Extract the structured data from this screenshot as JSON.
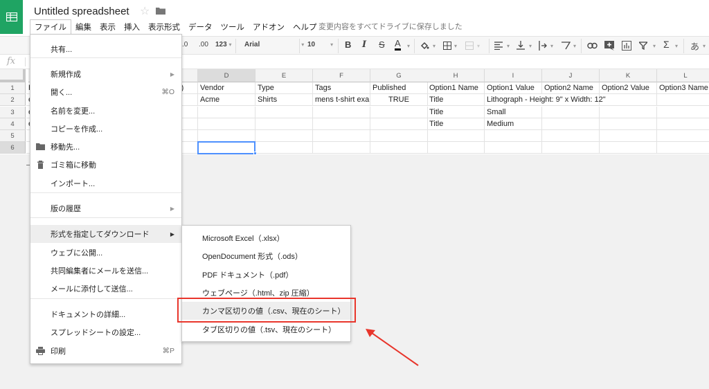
{
  "header": {
    "title": "Untitled spreadsheet",
    "star_icon": "star-outline-icon",
    "folder_icon": "folder-icon",
    "save_status": "変更内容をすべてドライブに保存しました",
    "menubar": [
      {
        "label": "ファイル",
        "active": true
      },
      {
        "label": "編集"
      },
      {
        "label": "表示"
      },
      {
        "label": "挿入"
      },
      {
        "label": "表示形式"
      },
      {
        "label": "データ"
      },
      {
        "label": "ツール"
      },
      {
        "label": "アドオン"
      },
      {
        "label": "ヘルプ"
      }
    ]
  },
  "toolbar": {
    "decrease_decimal": ".0",
    "increase_decimal": ".00",
    "number_format": "123",
    "font": "Arial",
    "font_size": "10",
    "bold": "B",
    "italic": "I",
    "strike": "S",
    "text_color": "A",
    "sigma": "Σ",
    "input_tools": "あ"
  },
  "formula_bar": {
    "fx_label": "fx",
    "value": ""
  },
  "grid": {
    "columns": [
      "D",
      "E",
      "F",
      "G",
      "H",
      "I",
      "J",
      "K",
      "L"
    ],
    "selected_column": "D",
    "rows": [
      "1",
      "2",
      "3",
      "4",
      "5",
      "6"
    ],
    "selected_row": "6",
    "partial_col_c_row1": "-)",
    "partial_col_a": [
      "H",
      "e",
      "e",
      "e",
      "",
      ""
    ],
    "cells": [
      [
        "Vendor",
        "Type",
        "Tags",
        "Published",
        "Option1 Name",
        "Option1 Value",
        "Option2 Name",
        "Option2 Value",
        "Option3 Name"
      ],
      [
        "Acme",
        "Shirts",
        "mens t-shirt exar",
        "TRUE",
        "Title",
        "Lithograph - Height: 9\" x Width: 12\"",
        "",
        "",
        ""
      ],
      [
        "",
        "",
        "",
        "",
        "Title",
        "Small",
        "",
        "",
        ""
      ],
      [
        "",
        "",
        "",
        "",
        "Title",
        "Medium",
        "",
        "",
        ""
      ],
      [
        "",
        "",
        "",
        "",
        "",
        "",
        "",
        "",
        ""
      ],
      [
        "",
        "",
        "",
        "",
        "",
        "",
        "",
        "",
        ""
      ]
    ],
    "active_cell": "D6"
  },
  "file_menu": {
    "items": [
      {
        "label": "共有..."
      },
      {
        "label": "新規作成",
        "submenu": true
      },
      {
        "label": "開く...",
        "shortcut": "⌘O"
      },
      {
        "label": "名前を変更..."
      },
      {
        "label": "コピーを作成..."
      },
      {
        "label": "移動先...",
        "icon": "folder-icon"
      },
      {
        "label": "ゴミ箱に移動",
        "icon": "trash-icon"
      },
      {
        "label": "インポート..."
      },
      {
        "label": "版の履歴",
        "submenu": true
      },
      {
        "label": "形式を指定してダウンロード",
        "submenu": true,
        "highlighted": true
      },
      {
        "label": "ウェブに公開..."
      },
      {
        "label": "共同編集者にメールを送信..."
      },
      {
        "label": "メールに添付して送信..."
      },
      {
        "label": "ドキュメントの詳細..."
      },
      {
        "label": "スプレッドシートの設定..."
      },
      {
        "label": "印刷",
        "shortcut": "⌘P",
        "icon": "print-icon"
      }
    ]
  },
  "download_submenu": {
    "items": [
      {
        "label": "Microsoft Excel（.xlsx）"
      },
      {
        "label": "OpenDocument 形式（.ods）"
      },
      {
        "label": "PDF ドキュメント（.pdf）"
      },
      {
        "label": "ウェブページ（.html、zip 圧縮）"
      },
      {
        "label": "カンマ区切りの値（.csv、現在のシート）",
        "highlighted": true
      },
      {
        "label": "タブ区切りの値（.tsv、現在のシート）"
      }
    ]
  },
  "annotation": {
    "highlight_color": "#e8352b",
    "arrow_color": "#e8352b"
  },
  "colors": {
    "brand_green": "#1fa463",
    "selection_blue": "#4d90fe"
  }
}
